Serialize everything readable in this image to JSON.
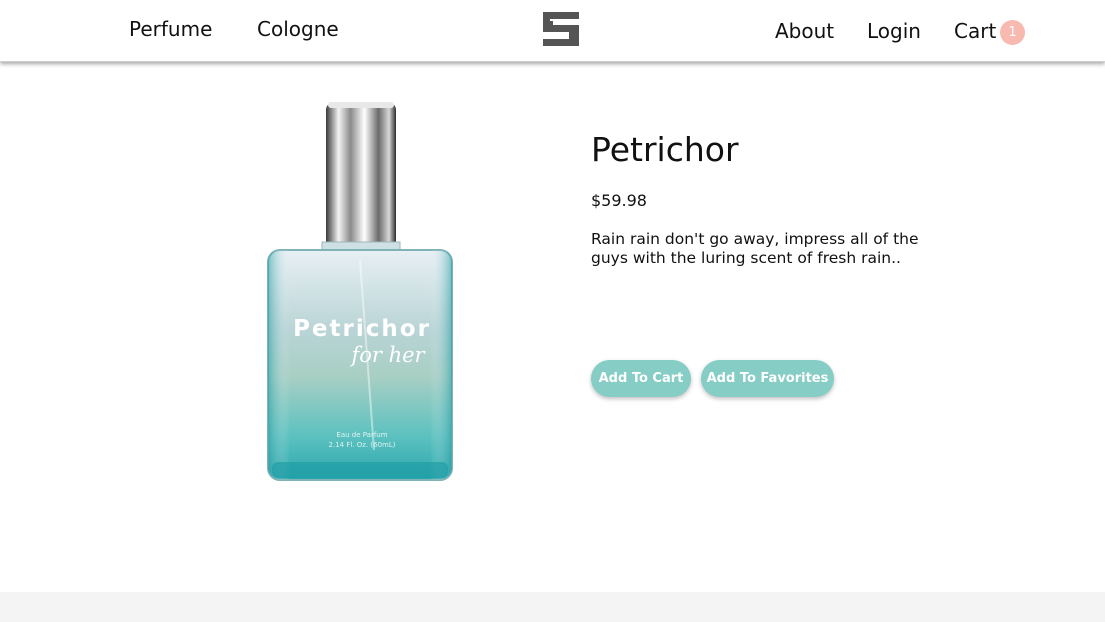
{
  "nav": {
    "left_links": [
      "Perfume",
      "Cologne"
    ],
    "right_links": [
      "About",
      "Login",
      "Cart"
    ],
    "cart_count": "1",
    "logo_icon": "stacked-s-logo-icon"
  },
  "product": {
    "name": "Petrichor",
    "price": "$59.98",
    "description": "Rain rain don't go away, impress all of the guys with the luring scent of fresh rain..",
    "image_icon": "perfume-bottle-image",
    "bottle_label": {
      "brand": "Petrichor",
      "subtitle": "for her",
      "type": "Eau de Parfum",
      "volume": "2.14 Fl. Oz. (60mL)"
    }
  },
  "actions": {
    "add_to_cart": "Add To Cart",
    "add_to_favorites": "Add To Favorites"
  },
  "colors": {
    "accent": "#86cdc6",
    "cart_badge": "#f8b9b0",
    "footer": "#f4f4f4"
  }
}
